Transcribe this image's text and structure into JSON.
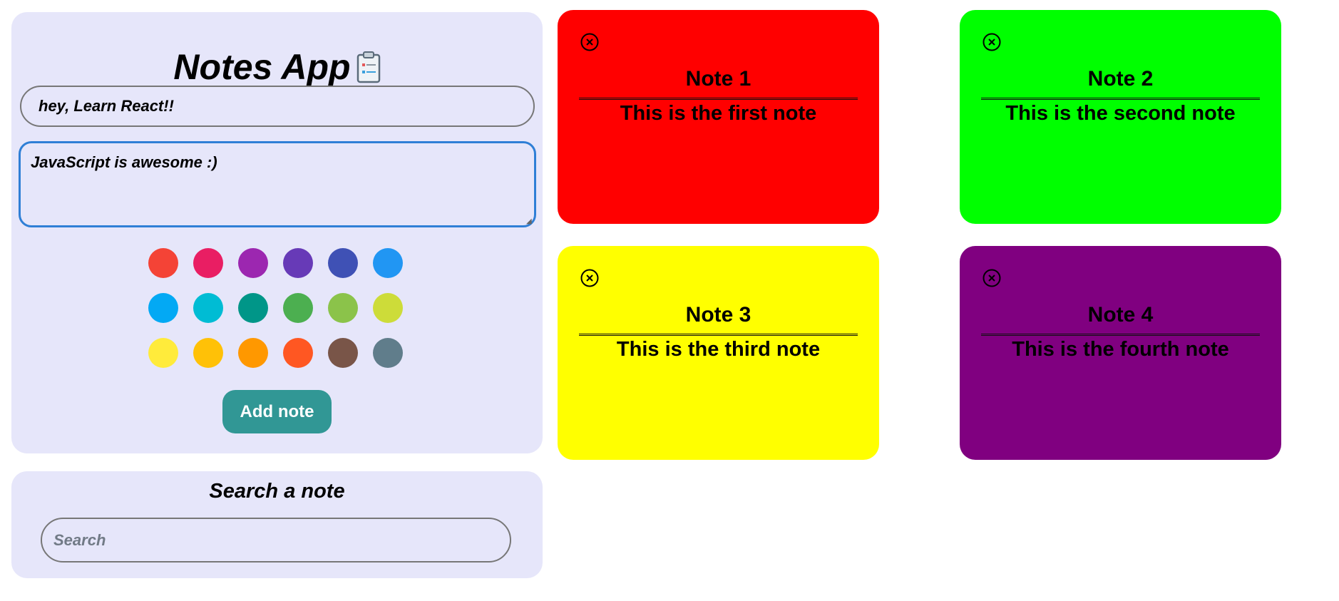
{
  "app": {
    "title": "Notes App",
    "title_icon": "clipboard-icon"
  },
  "editor": {
    "title_value": "hey, Learn React!!",
    "content_value": "JavaScript is awesome :)",
    "add_button_label": "Add note",
    "colors": [
      "#f44336",
      "#e91e63",
      "#9c27b0",
      "#673ab7",
      "#3f51b5",
      "#2196f3",
      "#03a9f4",
      "#00bcd4",
      "#009688",
      "#4caf50",
      "#8bc34a",
      "#cddc39",
      "#ffeb3b",
      "#ffc107",
      "#ff9800",
      "#ff5722",
      "#795548",
      "#607d8b"
    ]
  },
  "search": {
    "title": "Search a note",
    "placeholder": "Search",
    "value": ""
  },
  "notes": [
    {
      "title": "Note 1",
      "body": "This is the first note",
      "color": "#ff0000",
      "close_icon": "close-circle-icon"
    },
    {
      "title": "Note 2",
      "body": "This is the second note",
      "color": "#00ff00",
      "close_icon": "close-circle-icon"
    },
    {
      "title": "Note 3",
      "body": "This is the third note",
      "color": "#ffff00",
      "close_icon": "close-circle-icon"
    },
    {
      "title": "Note 4",
      "body": "This is the fourth note",
      "color": "#800080",
      "close_icon": "close-circle-icon"
    }
  ]
}
